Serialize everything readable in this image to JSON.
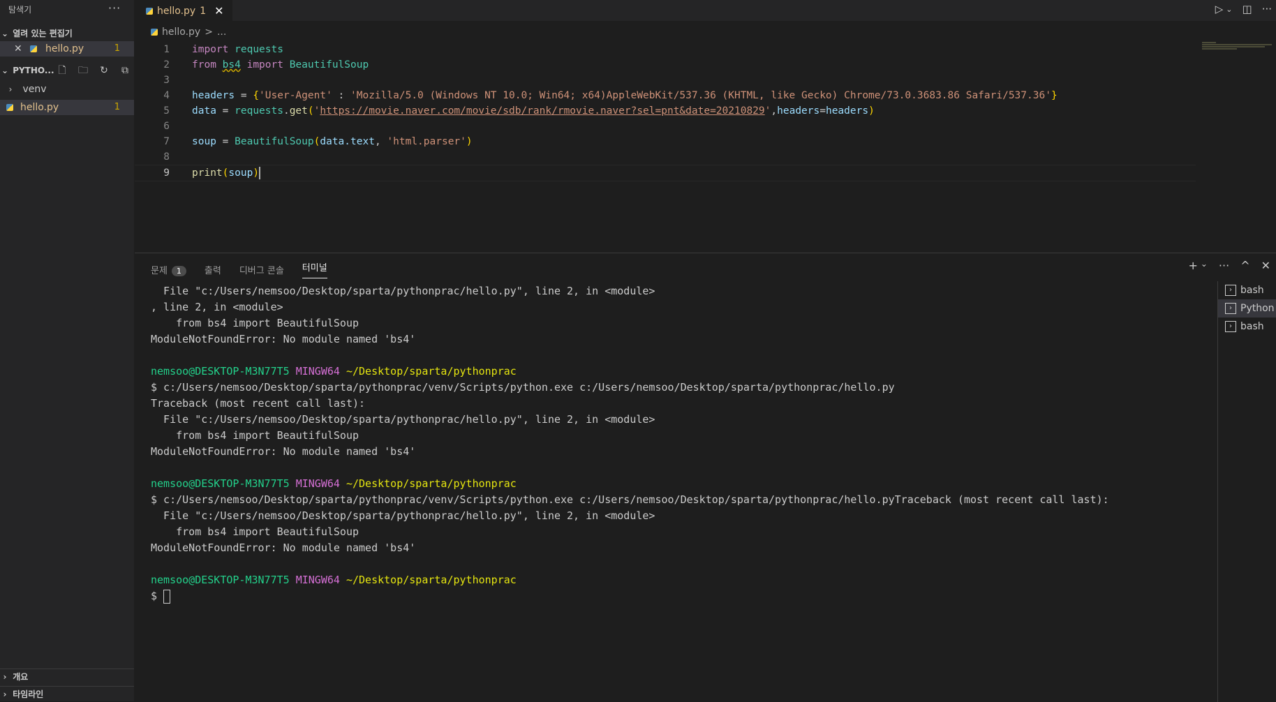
{
  "sidebar": {
    "title": "탐색기",
    "more": "···",
    "open_editors_label": "열려 있는 편집기",
    "open_editor": {
      "close": "✕",
      "name": "hello.py",
      "badge": "1"
    },
    "folder_label": "PYTHO...",
    "tree": [
      {
        "name": "venv",
        "badge": ""
      },
      {
        "name": "hello.py",
        "badge": "1"
      }
    ],
    "outline_label": "개요",
    "timeline_label": "타임라인"
  },
  "tab": {
    "name": "hello.py",
    "badge": "1",
    "close": "✕"
  },
  "breadcrumb": {
    "file": "hello.py",
    "sep": ">",
    "rest": "..."
  },
  "editor": {
    "line_numbers": [
      "1",
      "2",
      "3",
      "4",
      "5",
      "6",
      "7",
      "8",
      "9"
    ],
    "l1": {
      "kw": "import",
      "mod": "requests"
    },
    "l2": {
      "kw1": "from",
      "mod": "bs4",
      "kw2": "import",
      "cls": "BeautifulSoup"
    },
    "l4": {
      "var": "headers",
      "op": " = ",
      "open": "{",
      "key": "'User-Agent'",
      "colon": " : ",
      "val": "'Mozilla/5.0 (Windows NT 10.0; Win64; x64)AppleWebKit/537.36 (KHTML, like Gecko) Chrome/73.0.3683.86 Safari/537.36'",
      "close": "}"
    },
    "l5": {
      "var": "data",
      "op": " = ",
      "mod": "requests",
      "dot": ".",
      "fn": "get",
      "open": "(",
      "q1": "'",
      "url": "https://movie.naver.com/movie/sdb/rank/rmovie.naver?sel=pnt&date=20210829",
      "q2": "'",
      "comma": ",",
      "kwarg": "headers",
      "eq": "=",
      "arg": "headers",
      "close": ")"
    },
    "l7": {
      "var": "soup",
      "op": " = ",
      "cls": "BeautifulSoup",
      "open": "(",
      "arg1": "data.text",
      "comma": ", ",
      "str": "'html.parser'",
      "close": ")"
    },
    "l9": {
      "fn": "print",
      "open": "(",
      "arg": "soup",
      "close": ")"
    }
  },
  "panel": {
    "tabs": [
      {
        "label": "문제",
        "badge": "1"
      },
      {
        "label": "출력"
      },
      {
        "label": "디버그 콘솔"
      },
      {
        "label": "터미널"
      }
    ],
    "actions": {
      "add": "+",
      "add_chevron": "⌄",
      "more": "···",
      "maximize": "^",
      "close": "✕"
    }
  },
  "terminal": {
    "lines": [
      "  File \"c:/Users/nemsoo/Desktop/sparta/pythonprac/hello.py\", line 2, in <module>",
      ", line 2, in <module>",
      "    from bs4 import BeautifulSoup",
      "ModuleNotFoundError: No module named 'bs4'",
      "",
      "$ c:/Users/nemsoo/Desktop/sparta/pythonprac/venv/Scripts/python.exe c:/Users/nemsoo/Desktop/sparta/pythonprac/hello.py",
      "Traceback (most recent call last):",
      "  File \"c:/Users/nemsoo/Desktop/sparta/pythonprac/hello.py\", line 2, in <module>",
      "    from bs4 import BeautifulSoup",
      "ModuleNotFoundError: No module named 'bs4'",
      "",
      "$ c:/Users/nemsoo/Desktop/sparta/pythonprac/venv/Scripts/python.exe c:/Users/nemsoo/Desktop/sparta/pythonprac/hello.pyTraceback (most recent call last):",
      "  File \"c:/Users/nemsoo/Desktop/sparta/pythonprac/hello.py\", line 2, in <module>",
      "    from bs4 import BeautifulSoup",
      "ModuleNotFoundError: No module named 'bs4'",
      "",
      "$ "
    ],
    "prompt": {
      "user": "nemsoo@DESKTOP-M3N77T5",
      "host": "MINGW64",
      "path": "~/Desktop/sparta/pythonprac"
    }
  },
  "terminal_list": [
    {
      "label": "bash",
      "active": false
    },
    {
      "label": "Python",
      "active": true
    },
    {
      "label": "bash",
      "active": false
    }
  ],
  "colors": {
    "background": "#1e1e1e",
    "sidebar": "#252526",
    "warning": "#cca700",
    "prompt_user": "#23d18b",
    "prompt_host": "#d670d6",
    "prompt_path": "#e5e510"
  }
}
